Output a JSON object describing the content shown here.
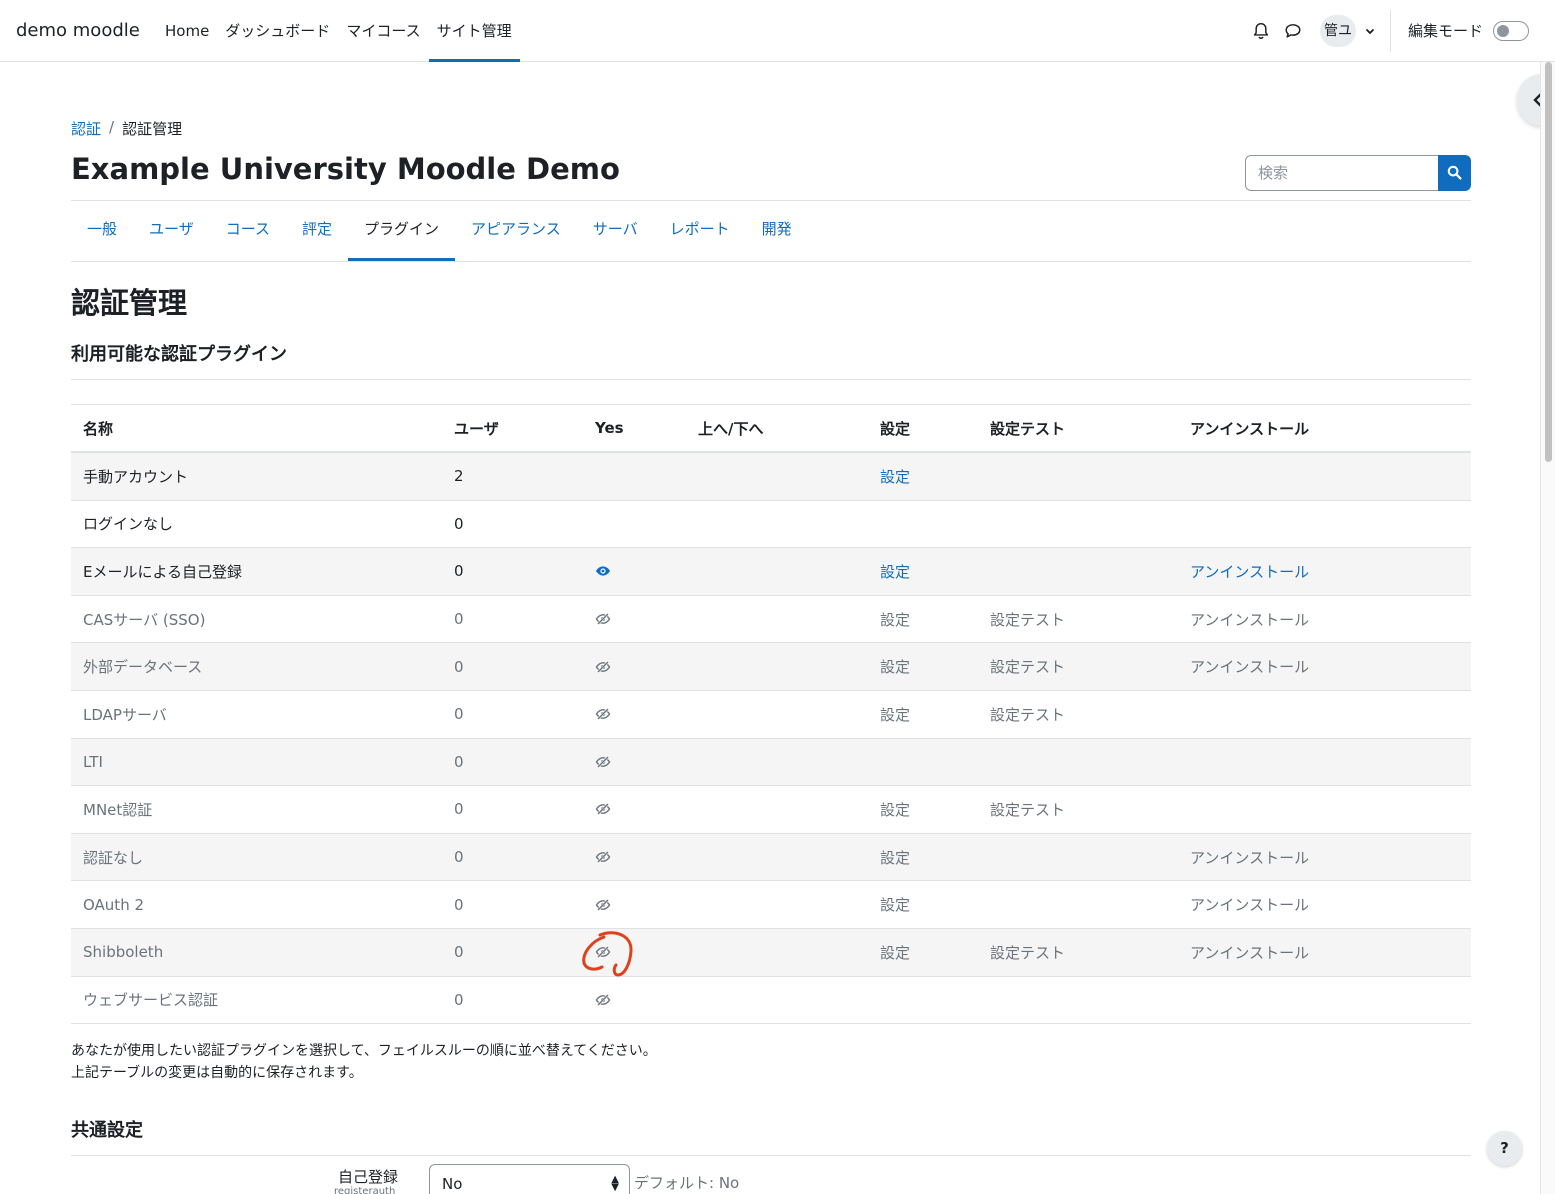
{
  "navbar": {
    "brand": "demo moodle",
    "items": [
      {
        "label": "Home"
      },
      {
        "label": "ダッシュボード"
      },
      {
        "label": "マイコース"
      },
      {
        "label": "サイト管理",
        "active": true
      }
    ],
    "avatar_initials": "管ユ",
    "edit_mode_label": "編集モード"
  },
  "breadcrumb": {
    "link": "認証",
    "current": "認証管理"
  },
  "heading": "Example University Moodle Demo",
  "search": {
    "placeholder": "検索"
  },
  "tabs": [
    "一般",
    "ユーザ",
    "コース",
    "評定",
    "プラグイン",
    "アピアランス",
    "サーバ",
    "レポート",
    "開発"
  ],
  "active_tab": "プラグイン",
  "page_title": "認証管理",
  "section_title": "利用可能な認証プラグイン",
  "table": {
    "headers": [
      "名称",
      "ユーザ",
      "Yes",
      "上へ/下へ",
      "設定",
      "設定テスト",
      "アンインストール"
    ],
    "rows": [
      {
        "name": "手動アカウント",
        "users": "2",
        "enabled": "",
        "settings": "設定",
        "test": "",
        "uninstall": "",
        "dim": false
      },
      {
        "name": "ログインなし",
        "users": "0",
        "enabled": "",
        "settings": "",
        "test": "",
        "uninstall": "",
        "dim": false
      },
      {
        "name": "Eメールによる自己登録",
        "users": "0",
        "enabled": "eye-icon",
        "settings": "設定",
        "test": "",
        "uninstall": "アンインストール",
        "dim": false
      },
      {
        "name": "CASサーバ (SSO)",
        "users": "0",
        "enabled": "eye-slash-icon",
        "settings": "設定",
        "test": "設定テスト",
        "uninstall": "アンインストール",
        "dim": true
      },
      {
        "name": "外部データベース",
        "users": "0",
        "enabled": "eye-slash-icon",
        "settings": "設定",
        "test": "設定テスト",
        "uninstall": "アンインストール",
        "dim": true
      },
      {
        "name": "LDAPサーバ",
        "users": "0",
        "enabled": "eye-slash-icon",
        "settings": "設定",
        "test": "設定テスト",
        "uninstall": "",
        "dim": true
      },
      {
        "name": "LTI",
        "users": "0",
        "enabled": "eye-slash-icon",
        "settings": "",
        "test": "",
        "uninstall": "",
        "dim": true
      },
      {
        "name": "MNet認証",
        "users": "0",
        "enabled": "eye-slash-icon",
        "settings": "設定",
        "test": "設定テスト",
        "uninstall": "",
        "dim": true
      },
      {
        "name": "認証なし",
        "users": "0",
        "enabled": "eye-slash-icon",
        "settings": "設定",
        "test": "",
        "uninstall": "アンインストール",
        "dim": true
      },
      {
        "name": "OAuth 2",
        "users": "0",
        "enabled": "eye-slash-icon",
        "settings": "設定",
        "test": "",
        "uninstall": "アンインストール",
        "dim": true
      },
      {
        "name": "Shibboleth",
        "users": "0",
        "enabled": "eye-slash-icon",
        "settings": "設定",
        "test": "設定テスト",
        "uninstall": "アンインストール",
        "dim": true
      },
      {
        "name": "ウェブサービス認証",
        "users": "0",
        "enabled": "eye-slash-icon",
        "settings": "",
        "test": "",
        "uninstall": "",
        "dim": true
      }
    ]
  },
  "note_lines": [
    "あなたが使用したい認証プラグインを選択して、フェイルスルーの順に並べ替えてください。",
    "上記テーブルの変更は自動的に保存されます。"
  ],
  "common_settings": {
    "title": "共通設定",
    "label": "自己登録",
    "sublabel": "registerauth",
    "value": "No",
    "default_text": "デフォルト: No"
  },
  "help_label": "?",
  "colors": {
    "link": "#0f6cbf",
    "annotation": "#e0401c"
  }
}
